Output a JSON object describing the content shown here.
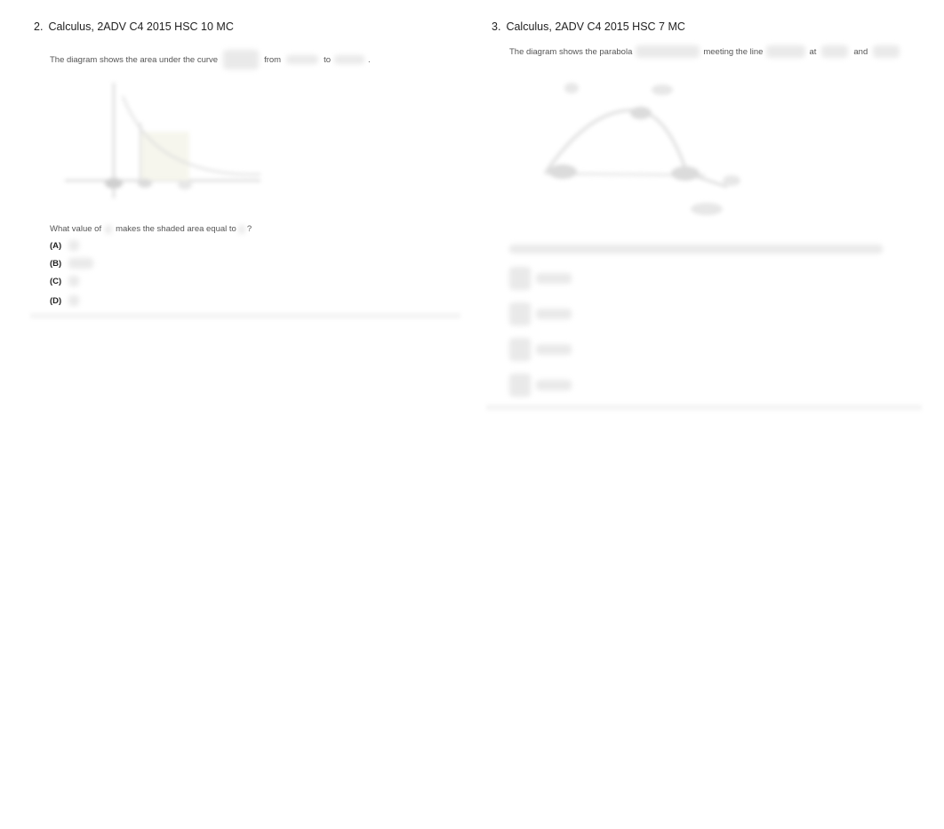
{
  "questions": [
    {
      "number": "2.",
      "title": "Calculus, 2ADV C4 2015 HSC 10 MC",
      "intro": {
        "part1": "The diagram shows the area under the curve",
        "part2": "from",
        "part3": "to",
        "part4": "."
      },
      "question": {
        "part1": "What value of",
        "part2": "makes the shaded area equal to",
        "part3": "?"
      },
      "options": [
        "(A)",
        "(B)",
        "(C)",
        "(D)"
      ]
    },
    {
      "number": "3.",
      "title": "Calculus, 2ADV C4 2015 HSC 7 MC",
      "intro": {
        "part1": "The diagram shows the parabola",
        "part2": "meeting the line",
        "part3": "at",
        "part4": "and"
      }
    }
  ]
}
